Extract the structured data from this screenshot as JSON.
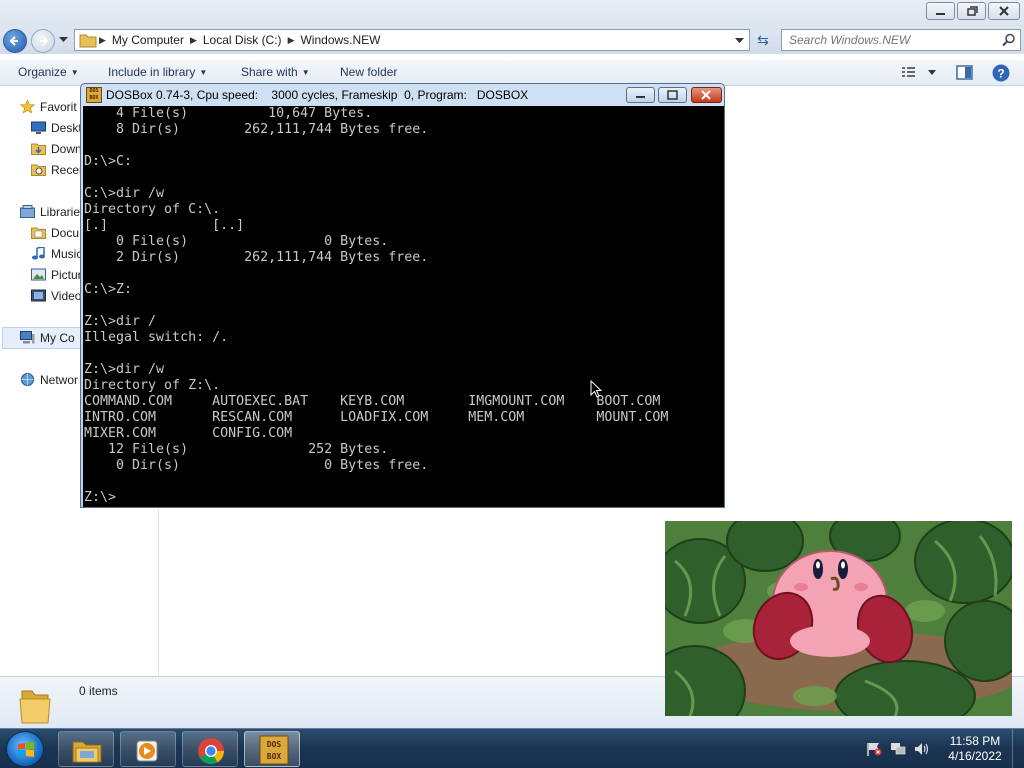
{
  "explorer": {
    "address": {
      "crumbs": [
        "My Computer",
        "Local Disk (C:)",
        "Windows.NEW"
      ]
    },
    "search": {
      "placeholder": "Search Windows.NEW"
    },
    "toolbar": {
      "organize": "Organize",
      "include_in_library": "Include in library",
      "share_with": "Share with",
      "new_folder": "New folder"
    },
    "nav": {
      "favorites": "Favorit",
      "desktop": "Deskt",
      "downloads": "Down",
      "recent": "Recen",
      "libraries": "Librarie",
      "documents": "Docu",
      "music": "Music",
      "pictures": "Pictur",
      "videos": "Video",
      "my_computer": "My Co",
      "network": "Networ"
    },
    "details": {
      "items": "0 items"
    }
  },
  "dosbox": {
    "title": "DOSBox 0.74-3, Cpu speed:    3000 cycles, Frameskip  0, Program:   DOSBOX",
    "screen_lines": [
      "    4 File(s)          10,647 Bytes.",
      "    8 Dir(s)        262,111,744 Bytes free.",
      "",
      "D:\\>C:",
      "",
      "C:\\>dir /w",
      "Directory of C:\\.",
      "[.]             [..]",
      "    0 File(s)                 0 Bytes.",
      "    2 Dir(s)        262,111,744 Bytes free.",
      "",
      "C:\\>Z:",
      "",
      "Z:\\>dir /",
      "Illegal switch: /.",
      "",
      "Z:\\>dir /w",
      "Directory of Z:\\.",
      "COMMAND.COM     AUTOEXEC.BAT    KEYB.COM        IMGMOUNT.COM    BOOT.COM",
      "INTRO.COM       RESCAN.COM      LOADFIX.COM     MEM.COM         MOUNT.COM",
      "MIXER.COM       CONFIG.COM",
      "   12 File(s)               252 Bytes.",
      "    0 Dir(s)                  0 Bytes free.",
      "",
      "Z:\\>"
    ]
  },
  "taskbar": {
    "time": "11:58 PM",
    "date": "4/16/2022",
    "pinned_icons": [
      "windows-explorer-icon",
      "media-player-icon",
      "chrome-icon",
      "dosbox-icon"
    ]
  },
  "colors": {
    "dos_text": "#c8c8c8",
    "dos_bg": "#000000",
    "taskbar": "#1c3450"
  }
}
